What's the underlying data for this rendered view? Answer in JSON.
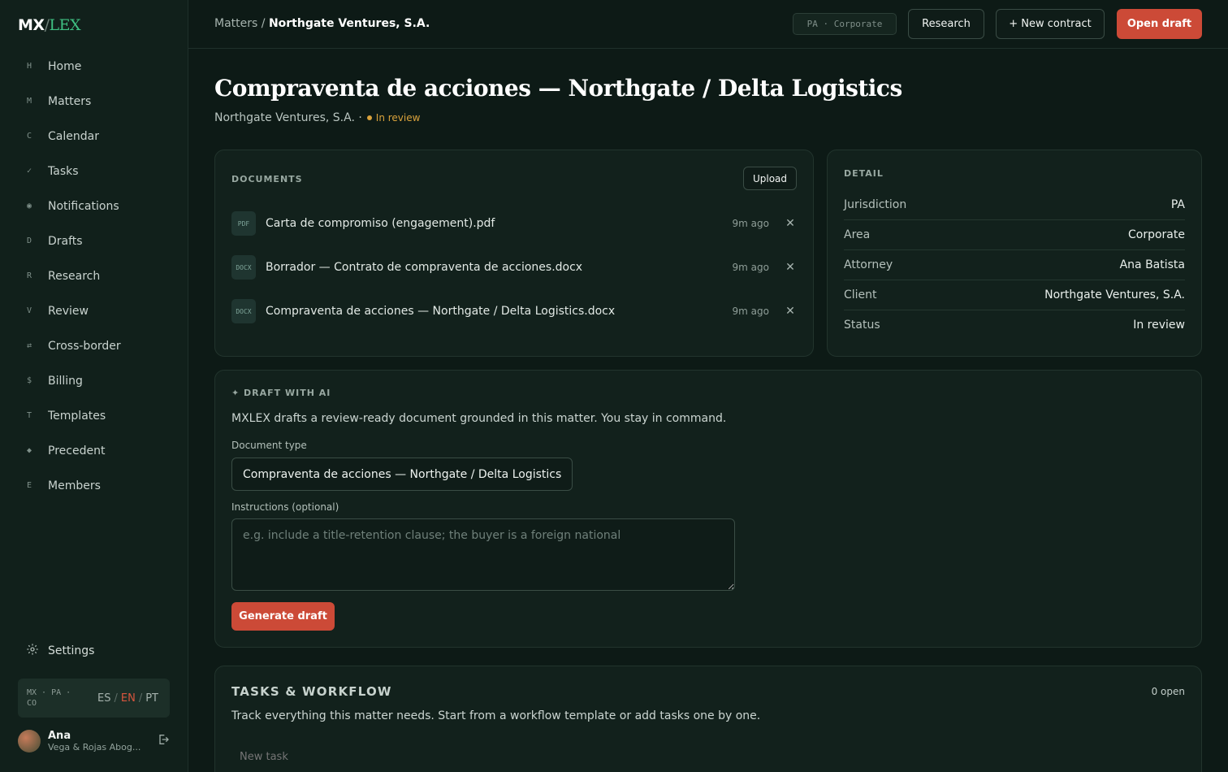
{
  "app": {
    "logo_mx": "MX",
    "logo_slash": "/",
    "logo_lex": "LEX"
  },
  "sidebar": {
    "items": [
      {
        "key": "H",
        "label": "Home"
      },
      {
        "key": "M",
        "label": "Matters"
      },
      {
        "key": "C",
        "label": "Calendar"
      },
      {
        "key": "✓",
        "label": "Tasks"
      },
      {
        "key": "◉",
        "label": "Notifications"
      },
      {
        "key": "D",
        "label": "Drafts"
      },
      {
        "key": "R",
        "label": "Research"
      },
      {
        "key": "V",
        "label": "Review"
      },
      {
        "key": "⇄",
        "label": "Cross-border"
      },
      {
        "key": "$",
        "label": "Billing"
      },
      {
        "key": "T",
        "label": "Templates"
      },
      {
        "key": "◆",
        "label": "Precedent"
      },
      {
        "key": "E",
        "label": "Members"
      }
    ],
    "settings_label": "Settings",
    "region_line1": "MX · PA ·",
    "region_line2": "CO",
    "lang_es": "ES",
    "lang_en": "EN",
    "lang_pt": "PT",
    "lang_sep": "/",
    "user_name": "Ana",
    "user_firm": "Vega & Rojas Abog..."
  },
  "topbar": {
    "breadcrumb_parent": "Matters",
    "breadcrumb_sep": "/",
    "breadcrumb_current": "Northgate Ventures, S.A.",
    "tag": "PA · Corporate",
    "research_btn": "Research",
    "new_contract_btn": "+ New contract",
    "open_draft_btn": "Open draft"
  },
  "matter": {
    "title": "Compraventa de acciones — Northgate / Delta Logistics",
    "client_line": "Northgate Ventures, S.A. ·",
    "status": "In review"
  },
  "documents": {
    "label": "DOCUMENTS",
    "upload_btn": "Upload",
    "items": [
      {
        "type": "PDF",
        "name": "Carta de compromiso (engagement).pdf",
        "time": "9m ago"
      },
      {
        "type": "DOCX",
        "name": "Borrador — Contrato de compraventa de acciones.docx",
        "time": "9m ago"
      },
      {
        "type": "DOCX",
        "name": "Compraventa de acciones — Northgate / Delta Logistics.docx",
        "time": "9m ago"
      }
    ]
  },
  "detail": {
    "label": "DETAIL",
    "rows": [
      {
        "k": "Jurisdiction",
        "v": "PA"
      },
      {
        "k": "Area",
        "v": "Corporate"
      },
      {
        "k": "Attorney",
        "v": "Ana Batista"
      },
      {
        "k": "Client",
        "v": "Northgate Ventures, S.A."
      },
      {
        "k": "Status",
        "v": "In review"
      }
    ]
  },
  "draft_ai": {
    "label": "✦ DRAFT WITH AI",
    "description": "MXLEX drafts a review-ready document grounded in this matter. You stay in command.",
    "doc_type_label": "Document type",
    "doc_type_value": "Compraventa de acciones — Northgate / Delta Logistics",
    "instructions_label": "Instructions (optional)",
    "instructions_placeholder": "e.g. include a title-retention clause; the buyer is a foreign national",
    "generate_btn": "Generate draft"
  },
  "tasks": {
    "title": "TASKS & WORKFLOW",
    "open_count": "0 open",
    "description": "Track everything this matter needs. Start from a workflow template or add tasks one by one.",
    "new_task_placeholder": "New task"
  }
}
